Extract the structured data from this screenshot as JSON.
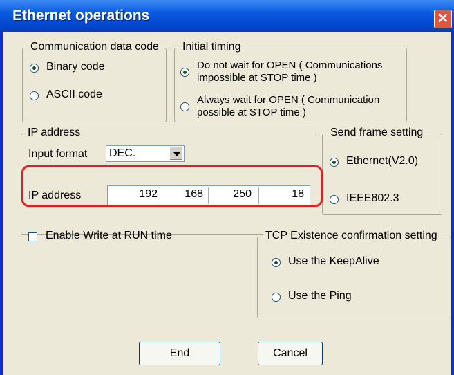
{
  "window": {
    "title": "Ethernet operations",
    "close_icon": "close-icon"
  },
  "comm_code": {
    "legend": "Communication data code",
    "options": [
      {
        "label": "Binary code",
        "selected": true
      },
      {
        "label": "ASCII code",
        "selected": false
      }
    ]
  },
  "initial_timing": {
    "legend": "Initial timing",
    "options": [
      {
        "line1": "Do not wait for OPEN ( Communications",
        "line2": "impossible at STOP time )",
        "selected": true
      },
      {
        "line1": "Always wait for OPEN ( Communication",
        "line2": "possible at STOP time )",
        "selected": false
      }
    ]
  },
  "ip": {
    "legend": "IP address",
    "input_format_label": "Input format",
    "input_format_value": "DEC.",
    "address_label": "IP address",
    "octets": [
      "192",
      "168",
      "250",
      "18"
    ]
  },
  "send_frame": {
    "legend": "Send frame setting",
    "options": [
      {
        "label": "Ethernet(V2.0)",
        "selected": true
      },
      {
        "label": "IEEE802.3",
        "selected": false
      }
    ]
  },
  "enable_write": {
    "label": "Enable Write at RUN time",
    "checked": false
  },
  "tcp": {
    "legend": "TCP Existence confirmation setting",
    "options": [
      {
        "label": "Use the KeepAlive",
        "selected": true
      },
      {
        "label": "Use the Ping",
        "selected": false
      }
    ]
  },
  "buttons": {
    "end": "End",
    "cancel": "Cancel"
  },
  "colors": {
    "title_bar": "#0a5ae0",
    "highlight": "#e02020",
    "dialog_bg": "#ece9d8"
  }
}
